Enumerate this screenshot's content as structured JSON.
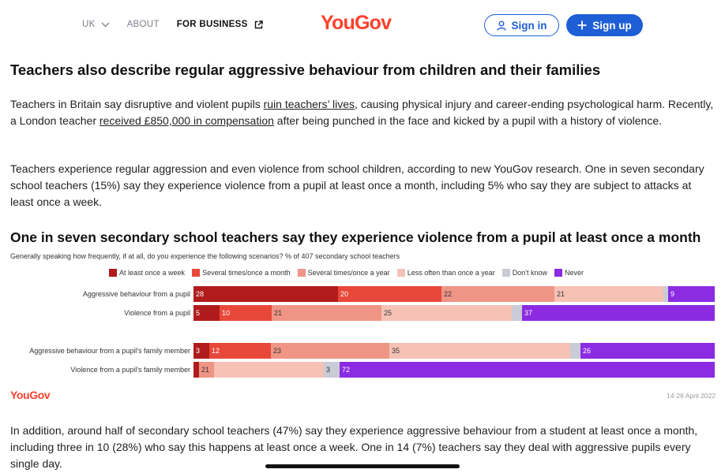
{
  "nav": {
    "region": "UK",
    "about": "ABOUT",
    "business": "FOR BUSINESS",
    "logo": "YouGov",
    "signin": "Sign in",
    "signup": "Sign up"
  },
  "article": {
    "heading1": "Teachers also describe regular aggressive behaviour from children and their families",
    "p1_a": "Teachers in Britain say disruptive and violent pupils ",
    "p1_link1": "ruin teachers’ lives",
    "p1_b": ", causing physical injury and career-ending psychological harm. Recently, a London teacher ",
    "p1_link2": "received £850,000 in compensation",
    "p1_c": " after being punched in the face and kicked by a pupil with a history of violence.",
    "p2": "Teachers experience regular aggression and even violence from school children, according to new YouGov research. One in seven secondary school teachers (15%) say they experience violence from a pupil at least once a month, including 5% who say they are subject to attacks at least once a week.",
    "p3": "In addition, around half of secondary school teachers (47%) say they experience aggressive behaviour from a student at least once a month, including three in 10 (28%) who say this happens at least once a week. One in 14 (7%) teachers say they deal with aggressive pupils every single day."
  },
  "chart_data": {
    "type": "bar",
    "stacked": true,
    "orientation": "horizontal",
    "title": "One in seven secondary school teachers say they experience violence from a pupil at least once a month",
    "subtitle": "Generally speaking how frequently, if at all, do you experience the following scenarios? % of 407 secondary school teachers",
    "legend_position": "top",
    "categories": [
      "Aggressive behaviour from a pupil",
      "Violence from a pupil",
      "Aggressive behaviour from a pupil's family member",
      "Violence from a pupil's family member"
    ],
    "series": [
      {
        "name": "At least once a week",
        "color": "#b01c1c",
        "values": [
          28,
          5,
          3,
          1
        ]
      },
      {
        "name": "Several times/once a month",
        "color": "#e8483a",
        "values": [
          20,
          10,
          12,
          0
        ]
      },
      {
        "name": "Several times/once a year",
        "color": "#ef9585",
        "values": [
          22,
          21,
          23,
          3
        ]
      },
      {
        "name": "Less often than once a year",
        "color": "#f5c2b5",
        "values": [
          21,
          25,
          35,
          21
        ]
      },
      {
        "name": "Don't know",
        "color": "#c9ccd6",
        "values": [
          1,
          2,
          2,
          3
        ]
      },
      {
        "name": "Never",
        "color": "#8b2be2",
        "values": [
          9,
          37,
          26,
          72
        ]
      }
    ],
    "data_labels": [
      [
        "28",
        "20",
        "22",
        "21",
        "",
        "9"
      ],
      [
        "5",
        "10",
        "21",
        "25",
        "",
        "37"
      ],
      [
        "3",
        "12",
        "23",
        "35",
        "",
        "26"
      ],
      [
        "",
        "3",
        "21",
        "",
        "3",
        "72"
      ]
    ],
    "source_logo": "YouGov",
    "date": "14-26 April 2022"
  }
}
